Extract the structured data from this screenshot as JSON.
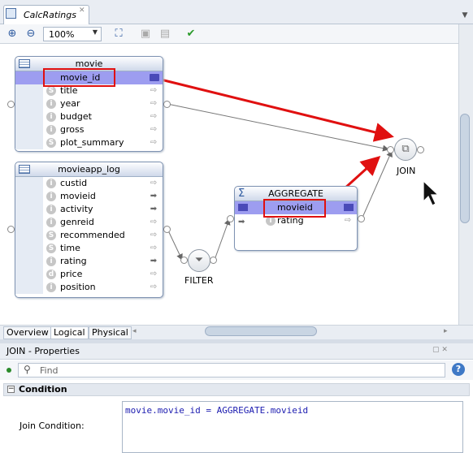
{
  "editor_tab": {
    "title": "CalcRatings"
  },
  "toolbar": {
    "zoom": "100%"
  },
  "movie": {
    "title": "movie",
    "columns": [
      {
        "name": "movie_id",
        "type": "",
        "selected": true
      },
      {
        "name": "title",
        "type": "S"
      },
      {
        "name": "year",
        "type": "i"
      },
      {
        "name": "budget",
        "type": "i"
      },
      {
        "name": "gross",
        "type": "i"
      },
      {
        "name": "plot_summary",
        "type": "S"
      }
    ]
  },
  "log": {
    "title": "movieapp_log",
    "columns": [
      {
        "name": "custid",
        "type": "i"
      },
      {
        "name": "movieid",
        "type": "i"
      },
      {
        "name": "activity",
        "type": "i"
      },
      {
        "name": "genreid",
        "type": "i"
      },
      {
        "name": "recommended",
        "type": "S"
      },
      {
        "name": "time",
        "type": "S"
      },
      {
        "name": "rating",
        "type": "i"
      },
      {
        "name": "price",
        "type": "d"
      },
      {
        "name": "position",
        "type": "i"
      }
    ]
  },
  "aggregate": {
    "title": "AGGREGATE",
    "columns": [
      {
        "name": "movieid",
        "type": ""
      },
      {
        "name": "rating",
        "type": "i"
      }
    ]
  },
  "filter": {
    "label": "FILTER"
  },
  "join": {
    "label": "JOIN"
  },
  "bottom_tabs": [
    "Overview",
    "Logical",
    "Physical"
  ],
  "properties": {
    "title": "JOIN - Properties",
    "find_placeholder": "Find",
    "section": "Condition",
    "join_condition_label": "Join Condition:",
    "join_condition": "movie.movie_id = AGGREGATE.movieid"
  }
}
